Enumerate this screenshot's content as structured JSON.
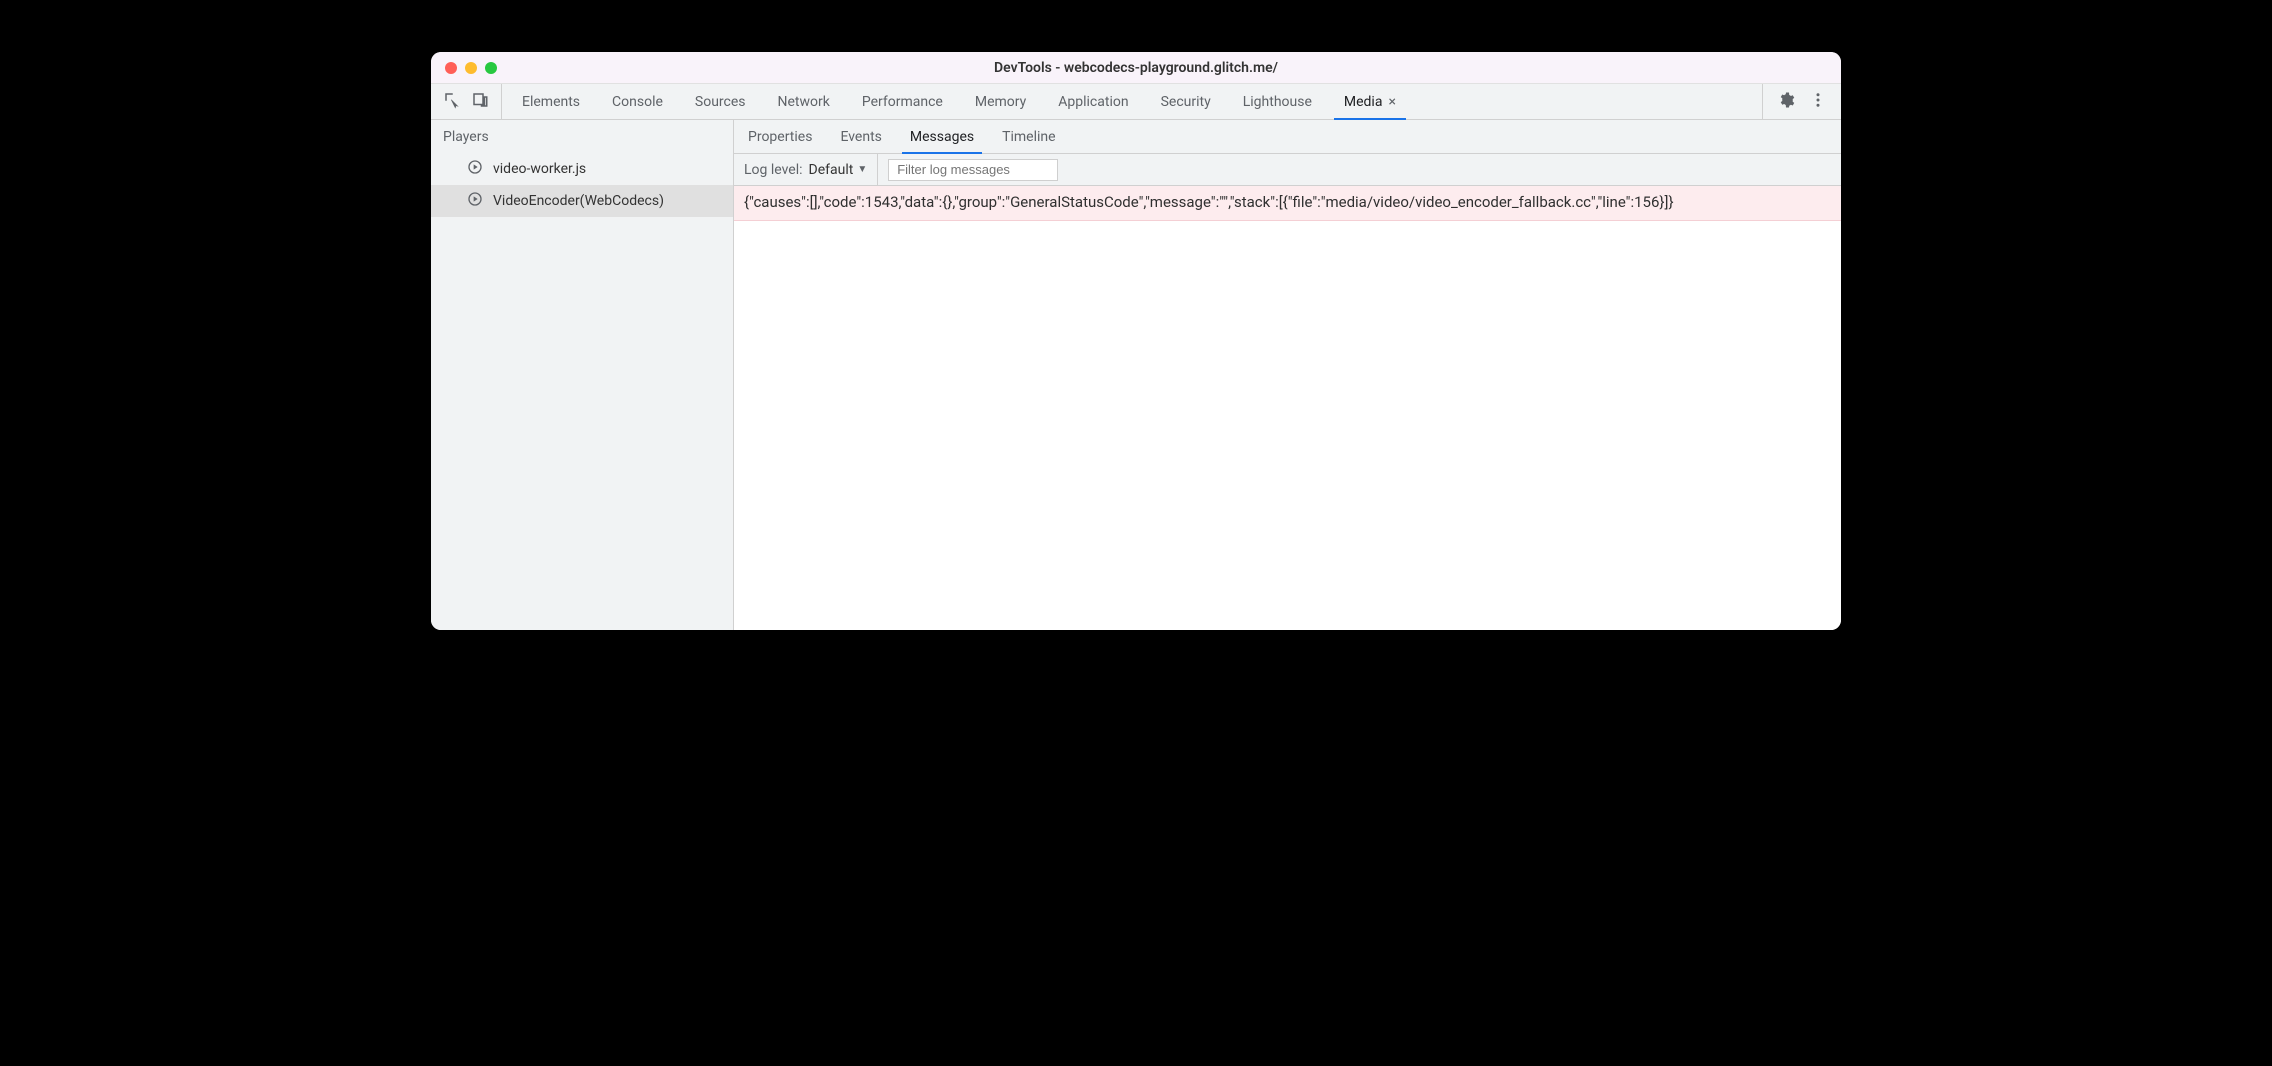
{
  "window": {
    "title": "DevTools - webcodecs-playground.glitch.me/"
  },
  "tabs": {
    "items": [
      {
        "label": "Elements",
        "active": false,
        "closable": false
      },
      {
        "label": "Console",
        "active": false,
        "closable": false
      },
      {
        "label": "Sources",
        "active": false,
        "closable": false
      },
      {
        "label": "Network",
        "active": false,
        "closable": false
      },
      {
        "label": "Performance",
        "active": false,
        "closable": false
      },
      {
        "label": "Memory",
        "active": false,
        "closable": false
      },
      {
        "label": "Application",
        "active": false,
        "closable": false
      },
      {
        "label": "Security",
        "active": false,
        "closable": false
      },
      {
        "label": "Lighthouse",
        "active": false,
        "closable": false
      },
      {
        "label": "Media",
        "active": true,
        "closable": true
      }
    ]
  },
  "sidebar": {
    "header": "Players",
    "players": [
      {
        "label": "video-worker.js",
        "selected": false
      },
      {
        "label": "VideoEncoder(WebCodecs)",
        "selected": true
      }
    ]
  },
  "subtabs": {
    "items": [
      {
        "label": "Properties",
        "active": false
      },
      {
        "label": "Events",
        "active": false
      },
      {
        "label": "Messages",
        "active": true
      },
      {
        "label": "Timeline",
        "active": false
      }
    ]
  },
  "filter": {
    "log_level_label": "Log level:",
    "log_level_value": "Default",
    "placeholder": "Filter log messages",
    "value": ""
  },
  "messages": [
    {
      "text": "{\"causes\":[],\"code\":1543,\"data\":{},\"group\":\"GeneralStatusCode\",\"message\":\"\",\"stack\":[{\"file\":\"media/video/video_encoder_fallback.cc\",\"line\":156}]}",
      "level": "error"
    }
  ]
}
